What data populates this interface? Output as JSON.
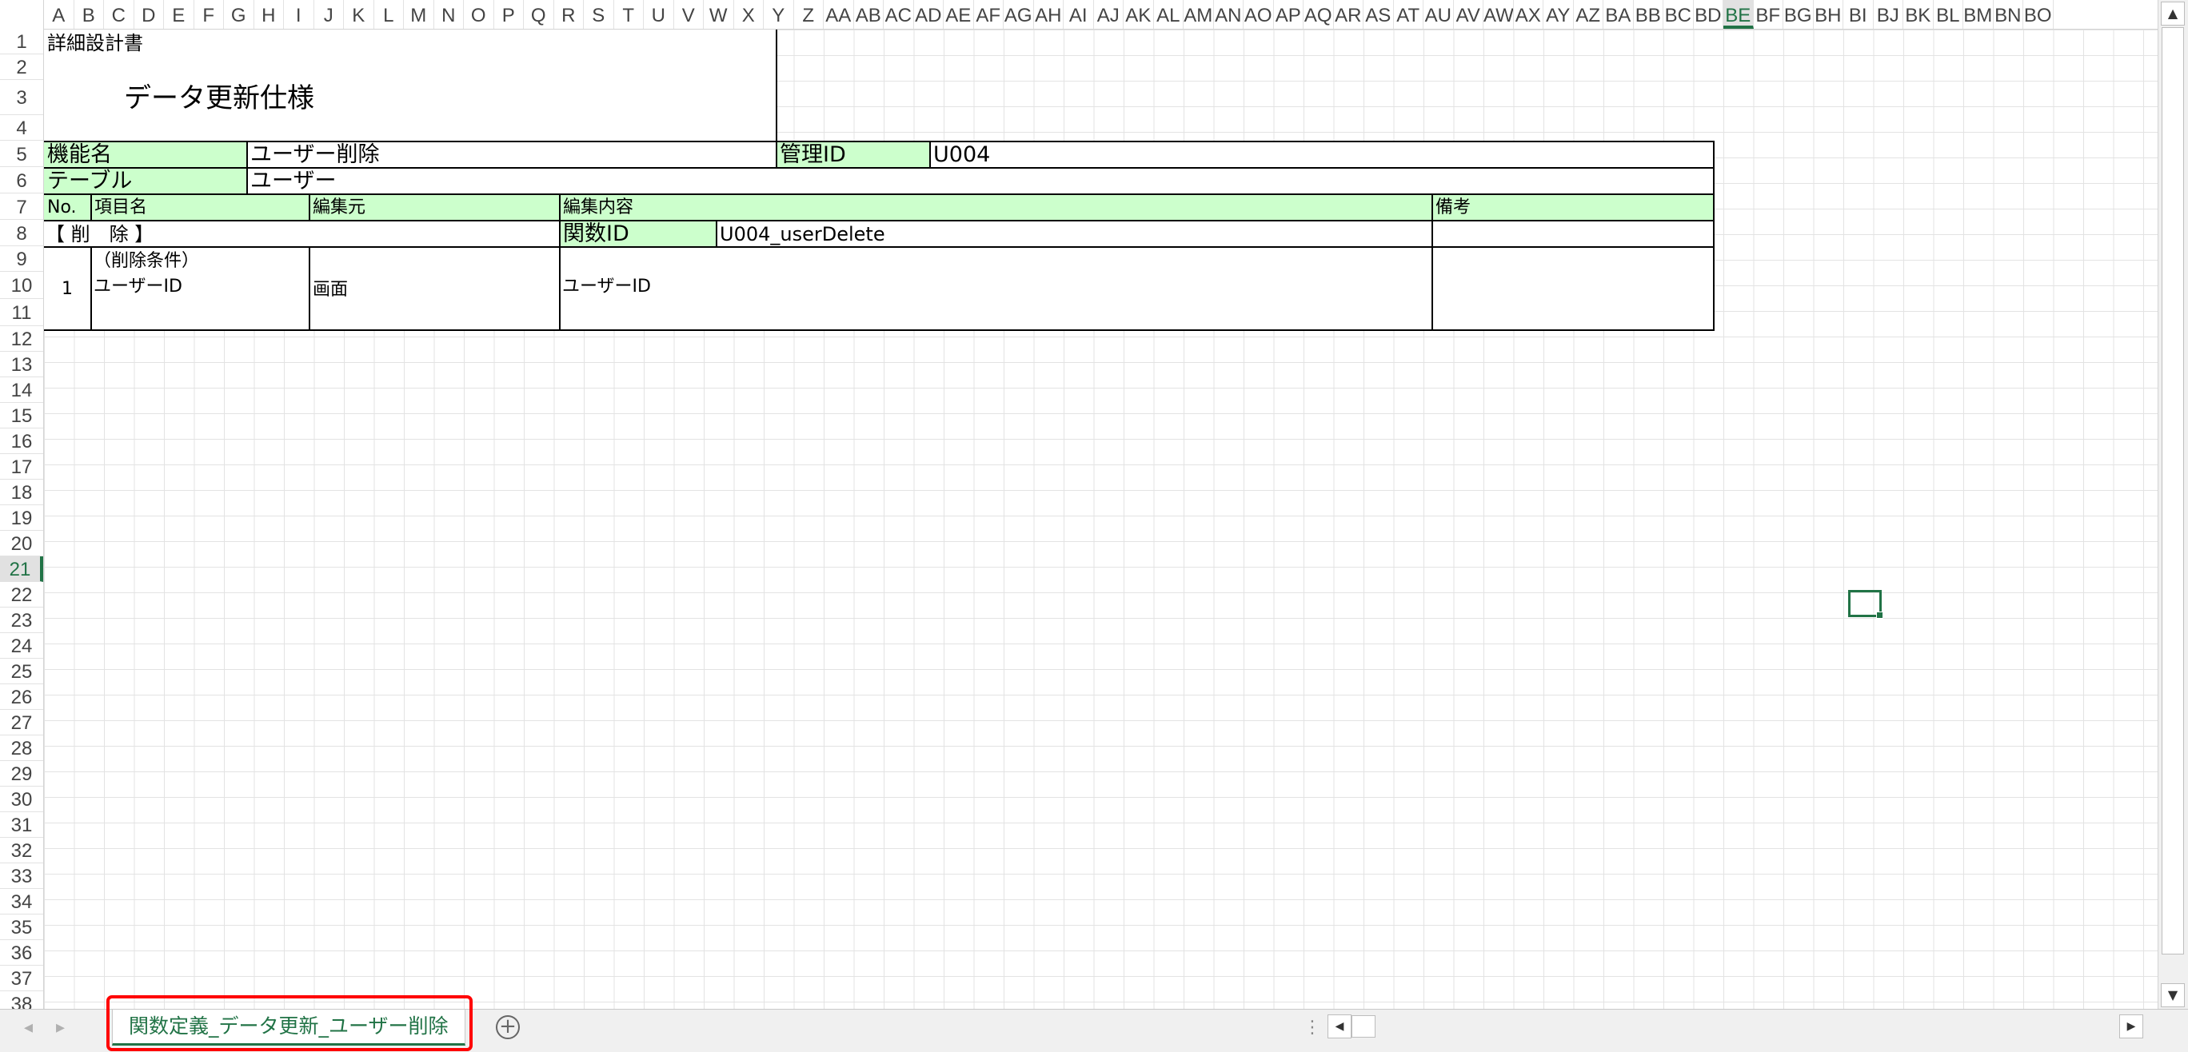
{
  "columns": [
    "A",
    "B",
    "C",
    "D",
    "E",
    "F",
    "G",
    "H",
    "I",
    "J",
    "K",
    "L",
    "M",
    "N",
    "O",
    "P",
    "Q",
    "R",
    "S",
    "T",
    "U",
    "V",
    "W",
    "X",
    "Y",
    "Z",
    "AA",
    "AB",
    "AC",
    "AD",
    "AE",
    "AF",
    "AG",
    "AH",
    "AI",
    "AJ",
    "AK",
    "AL",
    "AM",
    "AN",
    "AO",
    "AP",
    "AQ",
    "AR",
    "AS",
    "AT",
    "AU",
    "AV",
    "AW",
    "AX",
    "AY",
    "AZ",
    "BA",
    "BB",
    "BC",
    "BD",
    "BE",
    "BF",
    "BG",
    "BH",
    "BI",
    "BJ",
    "BK",
    "BL",
    "BM",
    "BN",
    "BO"
  ],
  "selected_column": "BE",
  "rows": [
    "1",
    "2",
    "3",
    "4",
    "5",
    "6",
    "7",
    "8",
    "9",
    "10",
    "11",
    "12",
    "13",
    "14",
    "15",
    "16",
    "17",
    "18",
    "19",
    "20",
    "21",
    "22",
    "23",
    "24",
    "25",
    "26",
    "27",
    "28",
    "29",
    "30",
    "31",
    "32",
    "33",
    "34",
    "35",
    "36",
    "37",
    "38"
  ],
  "selected_row": "21",
  "document": {
    "header": "詳細設計書",
    "title": "データ更新仕様",
    "function_name_label": "機能名",
    "function_name_value": "ユーザー削除",
    "management_id_label": "管理ID",
    "management_id_value": "U004",
    "table_label": "テーブル",
    "table_value": "ユーザー",
    "col_no": "No.",
    "col_item": "項目名",
    "col_source": "編集元",
    "col_content": "編集内容",
    "col_remarks": "備考",
    "section_delete": "【 削　除 】",
    "function_id_label": "関数ID",
    "function_id_value": "U004_userDelete",
    "condition_label": "（削除条件）",
    "row_no": "1",
    "row_item": "ユーザーID",
    "row_source": "画面",
    "row_content": "ユーザーID"
  },
  "sheet_tab": "関数定義_データ更新_ユーザー削除",
  "colors": {
    "accent": "#217346",
    "header_fill": "#ccffcc",
    "highlight": "#ff0000"
  }
}
